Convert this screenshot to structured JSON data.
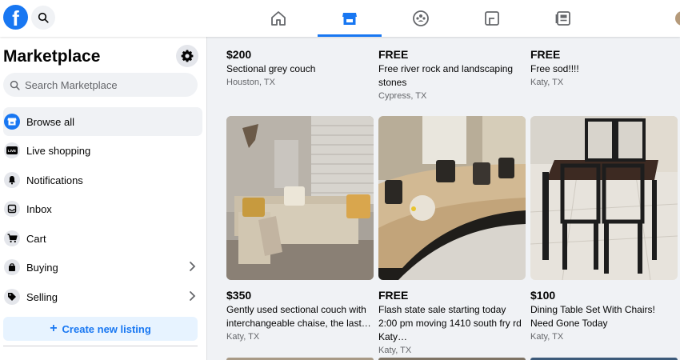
{
  "topbar": {
    "logo": "f",
    "nav_tabs": [
      "home",
      "marketplace",
      "groups",
      "gaming",
      "news"
    ],
    "active_tab": "marketplace"
  },
  "sidebar": {
    "title": "Marketplace",
    "search_placeholder": "Search Marketplace",
    "items": [
      {
        "label": "Browse all",
        "icon": "storefront-icon",
        "active": true
      },
      {
        "label": "Live shopping",
        "icon": "live-icon"
      },
      {
        "label": "Notifications",
        "icon": "bell-icon"
      },
      {
        "label": "Inbox",
        "icon": "inbox-icon"
      },
      {
        "label": "Cart",
        "icon": "cart-icon"
      },
      {
        "label": "Buying",
        "icon": "bag-icon",
        "chevron": true
      },
      {
        "label": "Selling",
        "icon": "tag-icon",
        "chevron": true
      }
    ],
    "create_label": "Create new listing",
    "live_badge": "LIVE"
  },
  "listings_top": [
    {
      "price": "$200",
      "title": "Sectional grey couch",
      "location": "Houston, TX"
    },
    {
      "price": "FREE",
      "title": "Free river rock and landscaping stones",
      "location": "Cypress, TX"
    },
    {
      "price": "FREE",
      "title": "Free sod!!!!",
      "location": "Katy, TX"
    }
  ],
  "listings_mid": [
    {
      "price": "$350",
      "title": "Gently used sectional couch with interchangeable chaise, the last…",
      "location": "Katy, TX"
    },
    {
      "price": "FREE",
      "title": "Flash state sale starting today 2:00 pm moving 1410 south fry rd Katy…",
      "location": "Katy, TX"
    },
    {
      "price": "$100",
      "title": "Dining Table Set With Chairs! Need Gone Today",
      "location": "Katy, TX"
    }
  ],
  "colors": {
    "accent": "#1877f2",
    "bg": "#f0f2f5"
  }
}
